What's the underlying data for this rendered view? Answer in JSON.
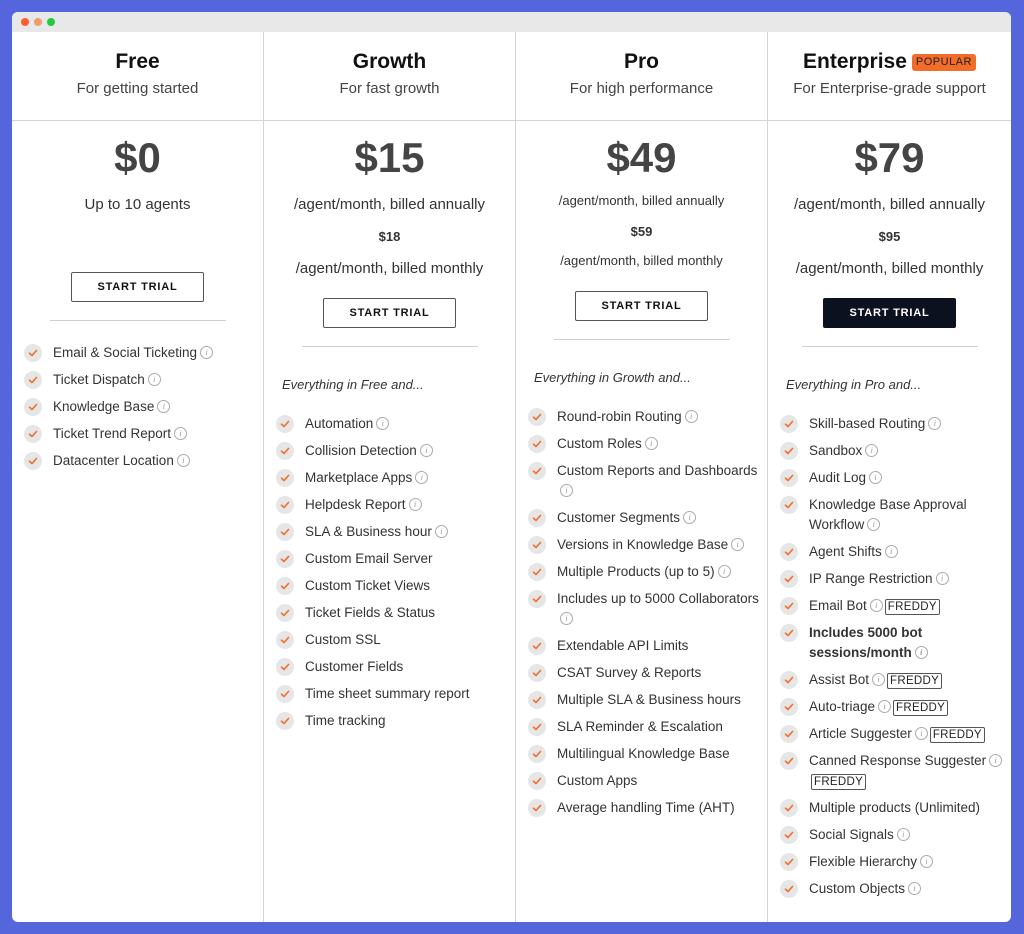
{
  "window": {
    "controls": [
      "close",
      "minimize",
      "maximize"
    ]
  },
  "plans": [
    {
      "name": "Free",
      "tagline": "For getting started",
      "price": "$0",
      "price_note": "Up to 10 agents",
      "cta": "START TRIAL",
      "features": [
        {
          "label": "Email & Social Ticketing",
          "info": true
        },
        {
          "label": "Ticket Dispatch",
          "info": true
        },
        {
          "label": "Knowledge Base",
          "info": true
        },
        {
          "label": "Ticket Trend Report",
          "info": true
        },
        {
          "label": "Datacenter Location",
          "info": true
        }
      ]
    },
    {
      "name": "Growth",
      "tagline": "For fast growth",
      "price": "$15",
      "price_note": "/agent/month, billed annually",
      "monthly_price": "$18",
      "monthly_note": "/agent/month, billed monthly",
      "cta": "START TRIAL",
      "intro": "Everything in Free and...",
      "features": [
        {
          "label": "Automation",
          "info": true
        },
        {
          "label": "Collision Detection",
          "info": true
        },
        {
          "label": "Marketplace Apps",
          "info": true
        },
        {
          "label": "Helpdesk Report",
          "info": true
        },
        {
          "label": "SLA & Business hour",
          "info": true
        },
        {
          "label": "Custom Email Server",
          "info": false
        },
        {
          "label": "Custom Ticket Views",
          "info": false
        },
        {
          "label": "Ticket Fields & Status",
          "info": false
        },
        {
          "label": "Custom SSL",
          "info": false
        },
        {
          "label": "Customer Fields",
          "info": false
        },
        {
          "label": "Time sheet summary report",
          "info": false
        },
        {
          "label": "Time tracking",
          "info": false
        }
      ]
    },
    {
      "name": "Pro",
      "tagline": "For high performance",
      "price": "$49",
      "price_note": "/agent/month, billed annually",
      "monthly_price": "$59",
      "monthly_note": "/agent/month, billed monthly",
      "cta": "START TRIAL",
      "intro": "Everything in Growth and...",
      "features": [
        {
          "label": "Round-robin Routing",
          "info": true
        },
        {
          "label": "Custom Roles",
          "info": true
        },
        {
          "label": "Custom Reports and Dashboards",
          "info": true
        },
        {
          "label": "Customer Segments",
          "info": true
        },
        {
          "label": "Versions in Knowledge Base",
          "info": true
        },
        {
          "label": "Multiple Products (up to 5)",
          "info": true
        },
        {
          "label": "Includes up to 5000 Collaborators",
          "info": true
        },
        {
          "label": "Extendable API Limits",
          "info": false
        },
        {
          "label": "CSAT Survey & Reports",
          "info": false
        },
        {
          "label": "Multiple SLA & Business hours",
          "info": false
        },
        {
          "label": "SLA Reminder & Escalation",
          "info": false
        },
        {
          "label": "Multilingual Knowledge Base",
          "info": false
        },
        {
          "label": "Custom Apps",
          "info": false
        },
        {
          "label": "Average handling Time (AHT)",
          "info": false
        }
      ]
    },
    {
      "name": "Enterprise",
      "badge": "POPULAR",
      "tagline": "For Enterprise-grade support",
      "price": "$79",
      "price_note": "/agent/month, billed annually",
      "monthly_price": "$95",
      "monthly_note": "/agent/month, billed monthly",
      "cta": "START TRIAL",
      "intro": "Everything in Pro and...",
      "features": [
        {
          "label": "Skill-based Routing",
          "info": true
        },
        {
          "label": "Sandbox",
          "info": true
        },
        {
          "label": "Audit Log",
          "info": true
        },
        {
          "label": "Knowledge Base Approval Workflow",
          "info": true
        },
        {
          "label": "Agent Shifts",
          "info": true
        },
        {
          "label": "IP Range Restriction",
          "info": true
        },
        {
          "label": "Email Bot",
          "info": true,
          "tag": "FREDDY"
        },
        {
          "label": "Includes 5000 bot sessions/month",
          "info": true,
          "bold": true
        },
        {
          "label": "Assist Bot",
          "info": true,
          "tag": "FREDDY"
        },
        {
          "label": "Auto-triage",
          "info": true,
          "tag": "FREDDY"
        },
        {
          "label": "Article Suggester",
          "info": true,
          "tag": "FREDDY"
        },
        {
          "label": "Canned Response Suggester",
          "info": true,
          "tag": "FREDDY"
        },
        {
          "label": "Multiple products (Unlimited)",
          "info": false
        },
        {
          "label": "Social Signals",
          "info": true
        },
        {
          "label": "Flexible Hierarchy",
          "info": true
        },
        {
          "label": "Custom Objects",
          "info": true
        }
      ]
    }
  ],
  "icons": {
    "check": "check-icon",
    "info": "info-icon"
  },
  "colors": {
    "accent": "#f26c2a",
    "background": "#5566dd",
    "dark_button": "#0c1120"
  }
}
